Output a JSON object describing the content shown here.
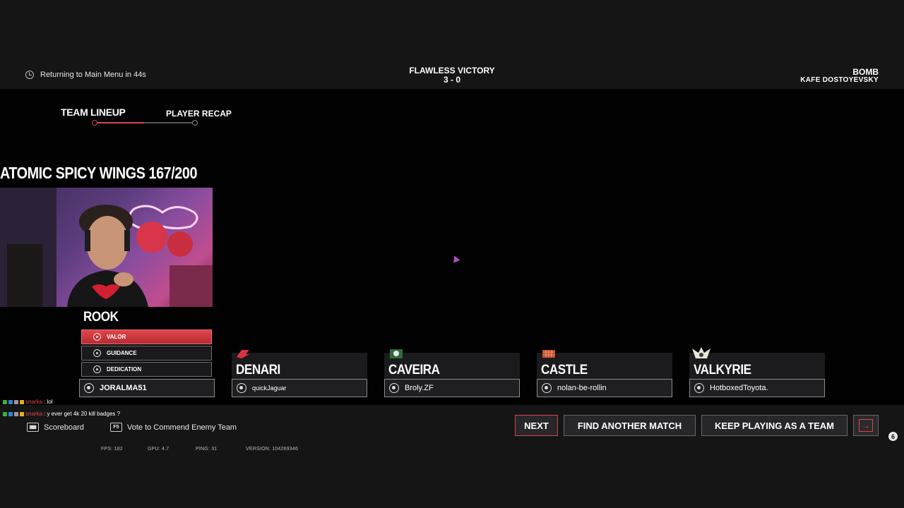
{
  "header": {
    "timer_text": "Returning to Main Menu in 44s",
    "result_title": "FLAWLESS VICTORY",
    "score": "3 - 0",
    "mode": "BOMB",
    "map": "KAFE DOSTOYEVSKY"
  },
  "tabs": {
    "lineup_label": "TEAM LINEUP",
    "recap_label": "PLAYER RECAP"
  },
  "stream_overlay": {
    "title": "ATOMIC SPICY WINGS 167/200"
  },
  "players": [
    {
      "operator": "ROOK",
      "name": "JORALMA51"
    },
    {
      "operator": "DENARI",
      "name": "quickJaguar"
    },
    {
      "operator": "CAVEIRA",
      "name": "Broly.ZF"
    },
    {
      "operator": "CASTLE",
      "name": "nolan-be-rollin"
    },
    {
      "operator": "VALKYRIE",
      "name": "HotboxedToyota."
    }
  ],
  "commendations": [
    {
      "label": "VALOR",
      "active": true
    },
    {
      "label": "GUIDANCE",
      "active": false
    },
    {
      "label": "DEDICATION",
      "active": false
    }
  ],
  "chat": [
    {
      "user": "snarka",
      "message": ": lol"
    },
    {
      "user": "snarka",
      "message": ": y ever get 4k 20 kill badges ?"
    }
  ],
  "hints": {
    "scoreboard_label": "Scoreboard",
    "commend_key": "F5",
    "commend_label": "Vote to Commend Enemy Team"
  },
  "stats": {
    "fps": "FPS: 182",
    "gpu": "GPU: 4.7",
    "ping": "PING: 31",
    "version": "VERSION: 104269346"
  },
  "buttons": {
    "next": "NEXT",
    "find_match": "FIND ANOTHER MATCH",
    "keep_playing": "KEEP PLAYING AS A TEAM",
    "exit_icon": "exit-arrow-icon"
  },
  "notification_count": "6",
  "colors": {
    "accent": "#d6454a",
    "background": "#020202",
    "bar": "#151515"
  }
}
